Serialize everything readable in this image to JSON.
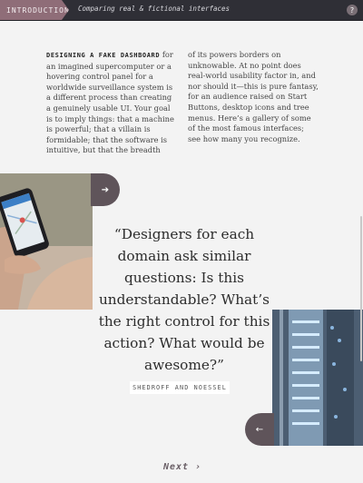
{
  "header": {
    "tab_label": "INTRODUCTION",
    "subtitle": "Comparing real & fictional interfaces",
    "help_label": "?"
  },
  "intro": {
    "lead": "DESIGNING A FAKE DASHBOARD",
    "col1_rest": "for an imagined supercomputer or a hovering control panel for a worldwide surveillance system is a different process than creating a genuinely usable UI. Your goal is to imply things: that a machine is powerful; that a villain is formidable; that the software is intuitive, but that the breadth",
    "col2": "of its powers borders on unknowable. At no point does real-world usability factor in, and nor should it—this is pure fantasy, for an audience raised on Start Buttons, desktop icons and tree menus. Here’s a gallery of some of the most famous interfaces; see how many you recognize."
  },
  "quote": {
    "text": "“Designers for each domain ask similar questions: Is this understandable? What’s the right control for this action? What would be awesome?”",
    "attribution": "SHEDROFF AND NOESSEL"
  },
  "nav": {
    "next_label": "Next",
    "next_icon": "›",
    "forward_arrow": "➔",
    "back_arrow": "←"
  },
  "colors": {
    "header_bg": "#2f2f36",
    "accent": "#8f6d78",
    "tab_bg": "#5f545a",
    "page_bg": "#f3f3f3"
  }
}
